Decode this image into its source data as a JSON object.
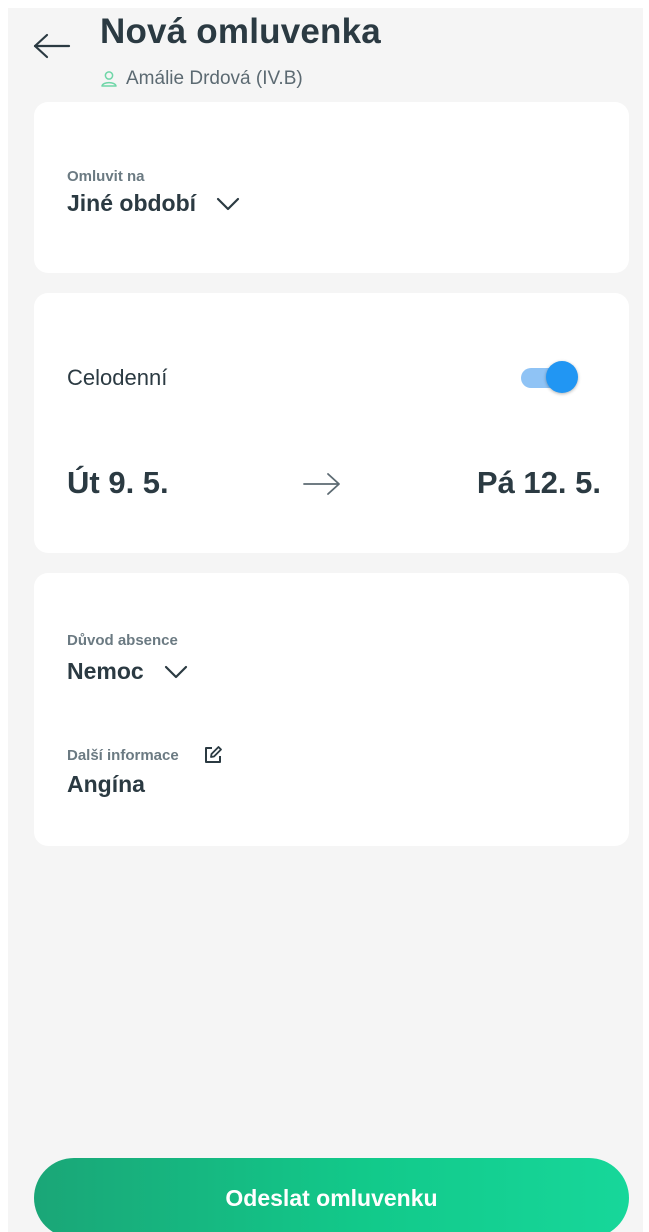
{
  "header": {
    "back_icon": "arrow-left-icon",
    "title": "Nová omluvenka",
    "student": "Amálie Drdová (IV.B)",
    "student_icon": "person-icon"
  },
  "excuse_for": {
    "label": "Omluvit na",
    "value": "Jiné období",
    "icon": "chevron-down-icon"
  },
  "period": {
    "full_day_label": "Celodenní",
    "full_day_enabled": true,
    "date_from": "Út 9. 5.",
    "date_to": "Pá 12. 5.",
    "arrow_icon": "arrow-right-icon"
  },
  "reason": {
    "label": "Důvod absence",
    "value": "Nemoc",
    "icon": "chevron-down-icon"
  },
  "details": {
    "label": "Další informace",
    "value": "Angína",
    "icon": "edit-icon"
  },
  "submit": {
    "label": "Odeslat omluvenku"
  },
  "colors": {
    "accent_green": "#12c98a",
    "toggle_blue": "#2196f3",
    "text_dark": "#2b3a42",
    "background": "#f5f5f5"
  }
}
